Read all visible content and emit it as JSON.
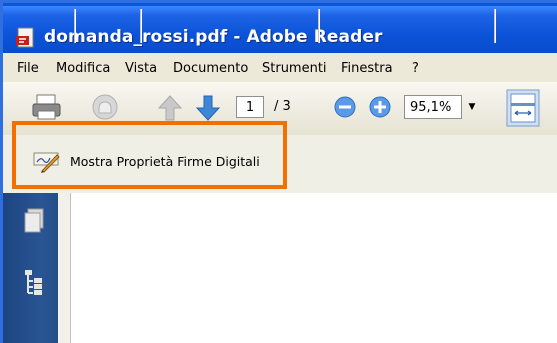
{
  "window": {
    "title": "domanda_rossi.pdf - Adobe Reader"
  },
  "menu": [
    {
      "label": "File"
    },
    {
      "label": "Modifica"
    },
    {
      "label": "Vista"
    },
    {
      "label": "Documento"
    },
    {
      "label": "Strumenti"
    },
    {
      "label": "Finestra"
    },
    {
      "label": "?"
    }
  ],
  "toolbar": {
    "current_page": "1",
    "page_total": "/ 3",
    "zoom": "95,1%"
  },
  "signature_bar": {
    "button_label": "Mostra Proprietà Firme Digitali"
  },
  "colors": {
    "titlebar": "#0a55d8",
    "highlight": "#f27000"
  }
}
